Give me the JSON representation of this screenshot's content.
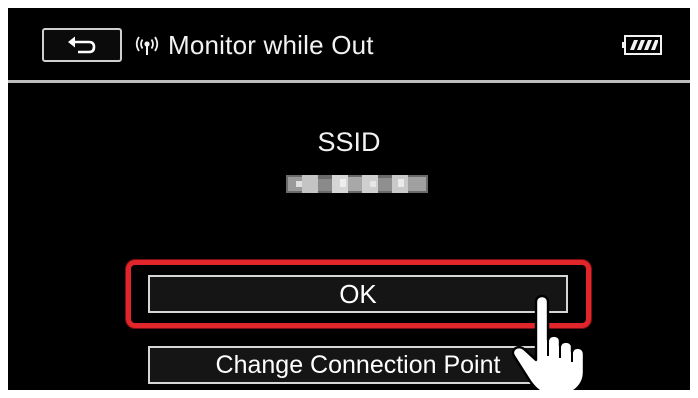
{
  "header": {
    "title": "Monitor while Out",
    "back_icon": "return-arrow-icon",
    "wifi_icon": "wifi-signal-icon",
    "battery_icon": "battery-full-icon"
  },
  "main": {
    "ssid_label": "SSID",
    "ssid_value_state": "pixelated-redacted"
  },
  "buttons": {
    "ok_label": "OK",
    "change_label": "Change Connection Point"
  },
  "overlay": {
    "highlight_color": "#e0262a",
    "pointer_icon": "pointing-hand-icon"
  }
}
